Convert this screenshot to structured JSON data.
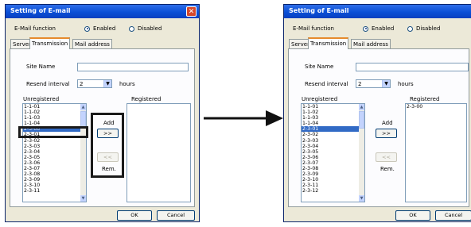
{
  "dialogs": [
    {
      "title": "Setting of E-mail",
      "email_function_label": "E-Mail function",
      "radio_enabled": "Enabled",
      "radio_disabled": "Disabled",
      "tabs": [
        "Server",
        "Transmission",
        "Mail address"
      ],
      "site_name_label": "Site Name",
      "site_name_value": "",
      "resend_label": "Resend interval",
      "resend_value": "2",
      "hours_label": "hours",
      "unregistered_label": "Unregistered",
      "registered_label": "Registered",
      "unregistered_items": [
        "1-1-01",
        "1-1-02",
        "1-1-03",
        "1-1-04",
        "2-3-00",
        "2-3-01",
        "2-3-02",
        "2-3-03",
        "2-3-04",
        "2-3-05",
        "2-3-06",
        "2-3-07",
        "2-3-08",
        "2-3-09",
        "2-3-10",
        "2-3-11"
      ],
      "selected_item": "2-3-00",
      "registered_items": [],
      "add_label": "Add",
      "add_button": ">>",
      "remove_button": "<<",
      "rem_label": "Rem.",
      "ok_label": "OK",
      "cancel_label": "Cancel"
    },
    {
      "title": "Setting of E-mail",
      "email_function_label": "E-Mail function",
      "radio_enabled": "Enabled",
      "radio_disabled": "Disabled",
      "tabs": [
        "Server",
        "Transmission",
        "Mail address"
      ],
      "site_name_label": "Site Name",
      "site_name_value": "",
      "resend_label": "Resend interval",
      "resend_value": "2",
      "hours_label": "hours",
      "unregistered_label": "Unregistered",
      "registered_label": "Registered",
      "unregistered_items": [
        "1-1-01",
        "1-1-02",
        "1-1-03",
        "1-1-04",
        "2-3-01",
        "2-3-02",
        "2-3-03",
        "2-3-04",
        "2-3-05",
        "2-3-06",
        "2-3-07",
        "2-3-08",
        "2-3-09",
        "2-3-10",
        "2-3-11",
        "2-3-12"
      ],
      "selected_item": "2-3-01",
      "registered_items": [
        "2-3-00"
      ],
      "add_label": "Add",
      "add_button": ">>",
      "remove_button": "<<",
      "rem_label": "Rem.",
      "ok_label": "OK",
      "cancel_label": "Cancel"
    }
  ],
  "colors": {
    "titlebar": "#0a4fd6",
    "selection": "#316ac5",
    "dialog_bg": "#ece9d8",
    "arrow": "#111111"
  }
}
